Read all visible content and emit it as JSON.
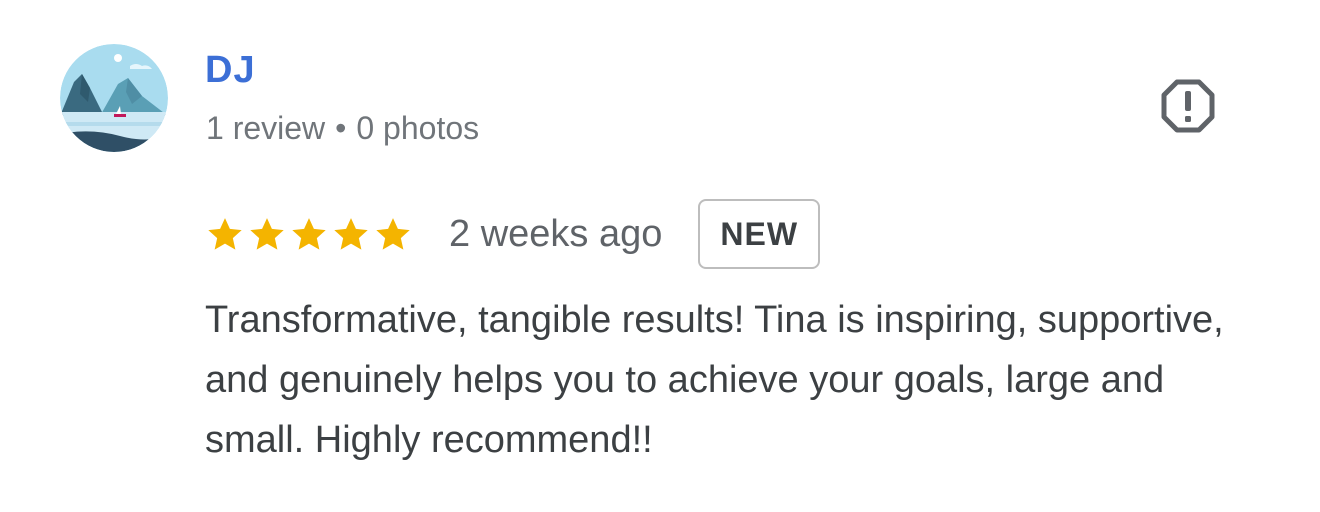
{
  "reviewer": {
    "name": "DJ",
    "review_count": "1 review",
    "separator": "•",
    "photo_count": "0 photos",
    "avatar_icon": "mountain-landscape-avatar"
  },
  "actions": {
    "flag_icon": "report-octagon-icon"
  },
  "review": {
    "rating": 5,
    "max_rating": 5,
    "date": "2 weeks ago",
    "badge": "NEW",
    "text": "Transformative, tangible results! Tina is inspiring, supportive, and genuinely helps you to achieve your goals, large and small. Highly recommend!!"
  },
  "colors": {
    "name": "#3c6fd6",
    "star": "#f4b400",
    "meta": "#70757a",
    "text": "#3c4043",
    "badge_border": "#bdbdbd",
    "flag_icon": "#5f6368"
  }
}
